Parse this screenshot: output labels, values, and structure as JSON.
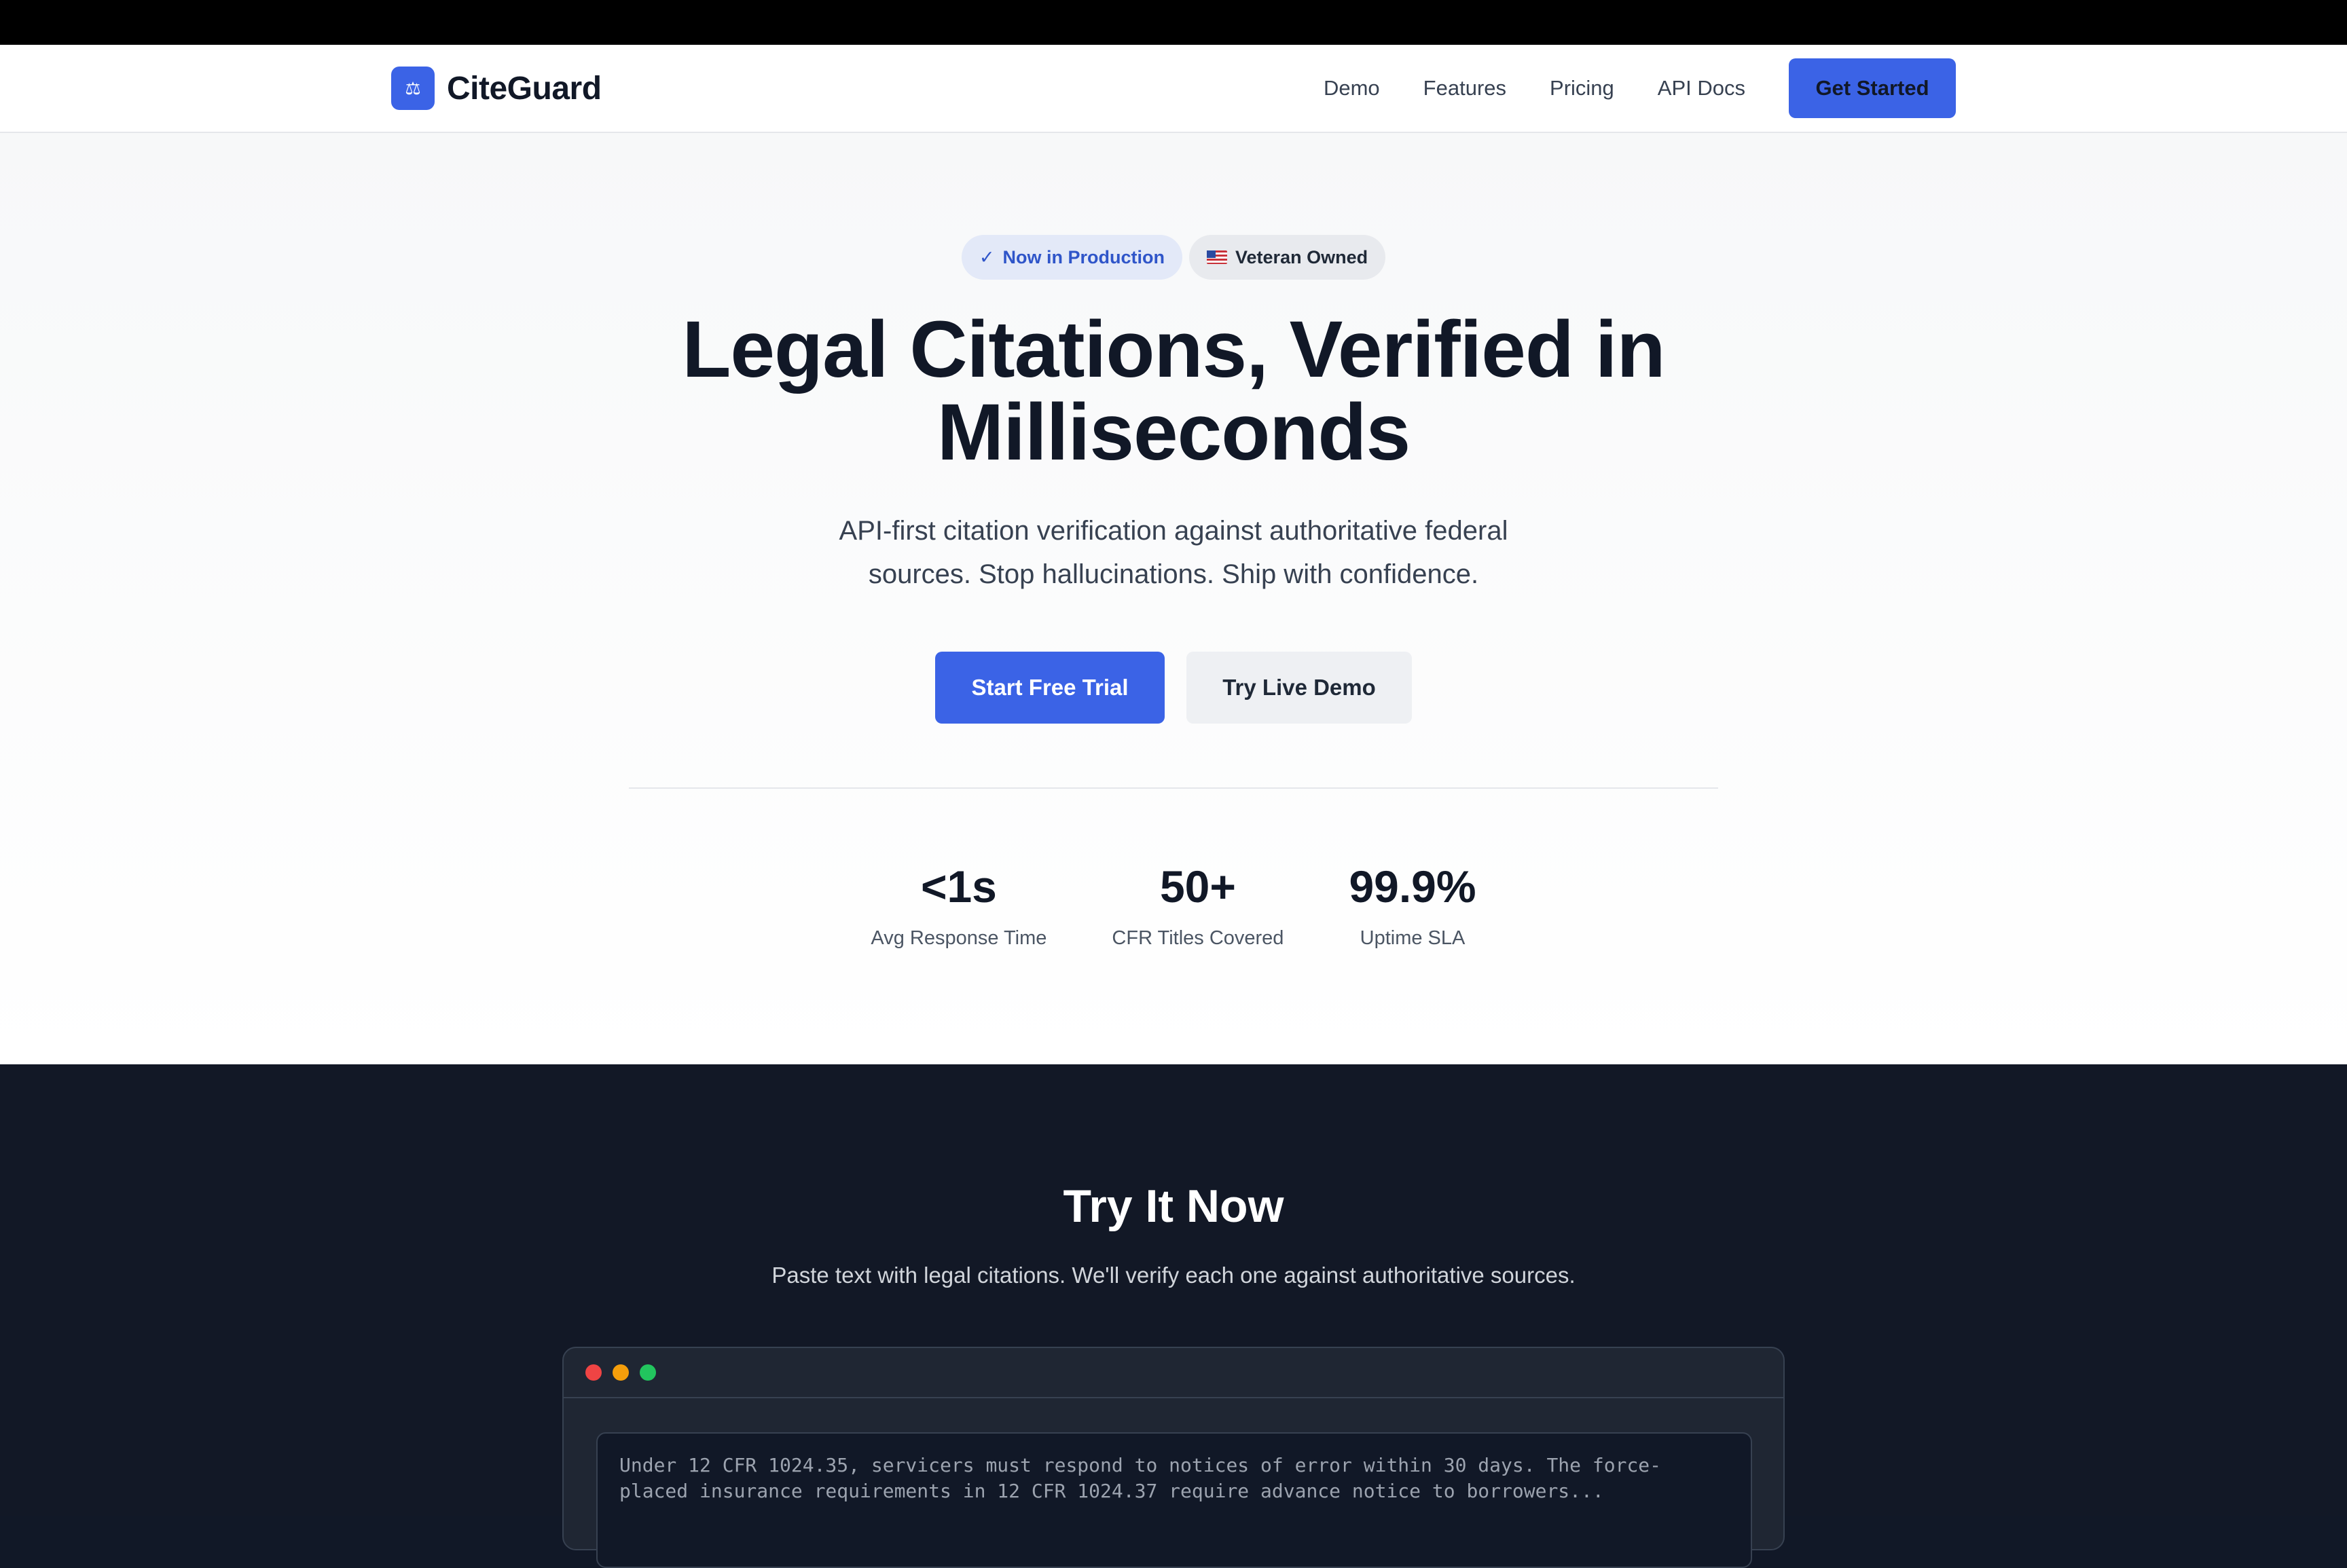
{
  "nav": {
    "logo_icon": "scales-icon",
    "logo_glyph": "⚖",
    "brand": "CiteGuard",
    "links": [
      "Demo",
      "Features",
      "Pricing",
      "API Docs"
    ],
    "cta": "Get Started"
  },
  "hero": {
    "badges": {
      "production": "Now in Production",
      "production_icon": "✓",
      "veteran": "Veteran Owned"
    },
    "headline_line1": "Legal Citations, Verified in",
    "headline_line2": "Milliseconds",
    "subhead_line1": "API-first citation verification against authoritative federal",
    "subhead_line2": "sources. Stop hallucinations. Ship with confidence.",
    "primary_button": "Start Free Trial",
    "secondary_button": "Try Live Demo",
    "stats": [
      {
        "value": "<1s",
        "label": "Avg Response Time"
      },
      {
        "value": "50+",
        "label": "CFR Titles Covered"
      },
      {
        "value": "99.9%",
        "label": "Uptime SLA"
      }
    ]
  },
  "demo": {
    "title": "Try It Now",
    "subtitle": "Paste text with legal citations. We'll verify each one against authoritative sources.",
    "input_text": "Under 12 CFR 1024.35, servicers must respond to notices of error within 30 days. The force-placed insurance requirements in 12 CFR 1024.37 require advance notice to borrowers..."
  },
  "colors": {
    "accent": "#3b63e6",
    "dark_section": "#121826",
    "dot_red": "#ef4444",
    "dot_yellow": "#f59e0b",
    "dot_green": "#22c55e"
  }
}
